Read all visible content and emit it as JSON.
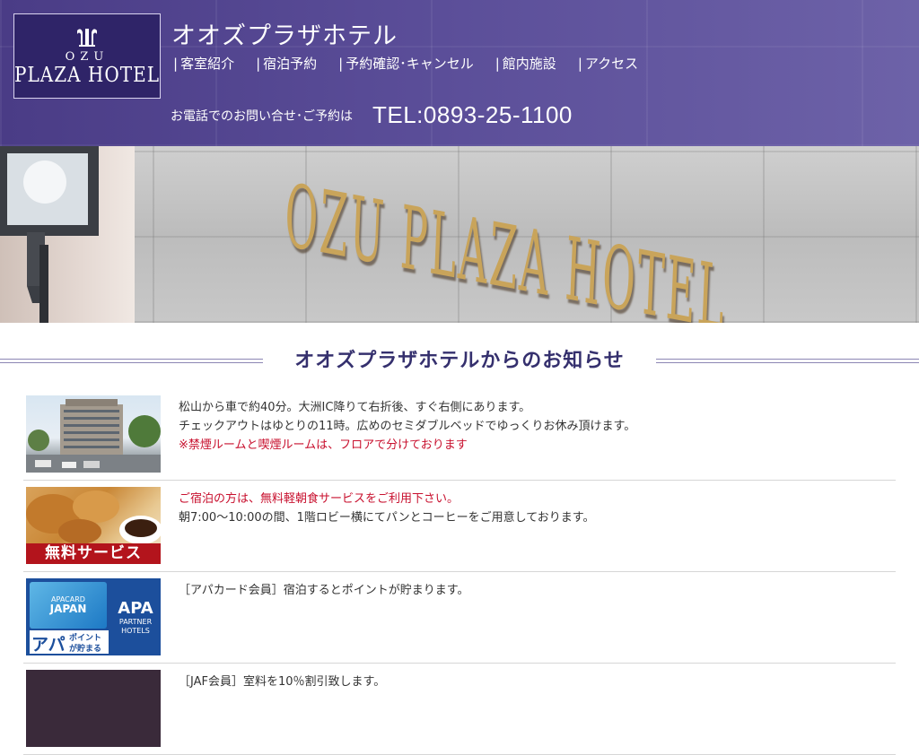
{
  "header": {
    "logo": {
      "line1": "OZU",
      "line2": "PLAZA HOTEL"
    },
    "site_title": "オオズプラザホテル",
    "nav": [
      {
        "label": "客室紹介"
      },
      {
        "label": "宿泊予約"
      },
      {
        "label": "予約確認･キャンセル"
      },
      {
        "label": "館内施設"
      },
      {
        "label": "アクセス"
      }
    ],
    "phone_label": "お電話でのお問い合せ･ご予約は",
    "phone_number": "TEL:0893-25-1100"
  },
  "hero": {
    "sign_text": "OZU PLAZA HOTEL"
  },
  "news": {
    "title": "オオズプラザホテルからのお知らせ",
    "items": [
      {
        "lines": [
          "松山から車で約40分。大洲IC降りて右折後、すぐ右側にあります。",
          "チェックアウトはゆとりの11時。広めのセミダブルベッドでゆっくりお休み頂けます。"
        ],
        "red": "※禁煙ルームと喫煙ルームは、フロアで分けております"
      },
      {
        "red": "ご宿泊の方は、無料軽朝食サービスをご利用下さい。",
        "lines": [
          "朝7:00〜10:00の間、1階ロビー横にてパンとコーヒーをご用意しております。"
        ],
        "thumb_caption": "無料サービス"
      },
      {
        "lines": [
          "［アパカード会員］宿泊するとポイントが貯まります。"
        ],
        "thumb_card": [
          "APACARD",
          "JAPAN"
        ],
        "thumb_logo": [
          "APA",
          "PARTNER",
          "HOTELS"
        ],
        "thumb_point": [
          "アパ",
          "ポイント",
          "が貯まる"
        ]
      },
      {
        "lines": [
          "［JAF会員］室料を10％割引致します。"
        ]
      }
    ]
  },
  "colors": {
    "header_band": "#4a3c86",
    "logo_bg": "#2f2468",
    "news_title": "#35306e",
    "notice_red": "#c8102e"
  }
}
